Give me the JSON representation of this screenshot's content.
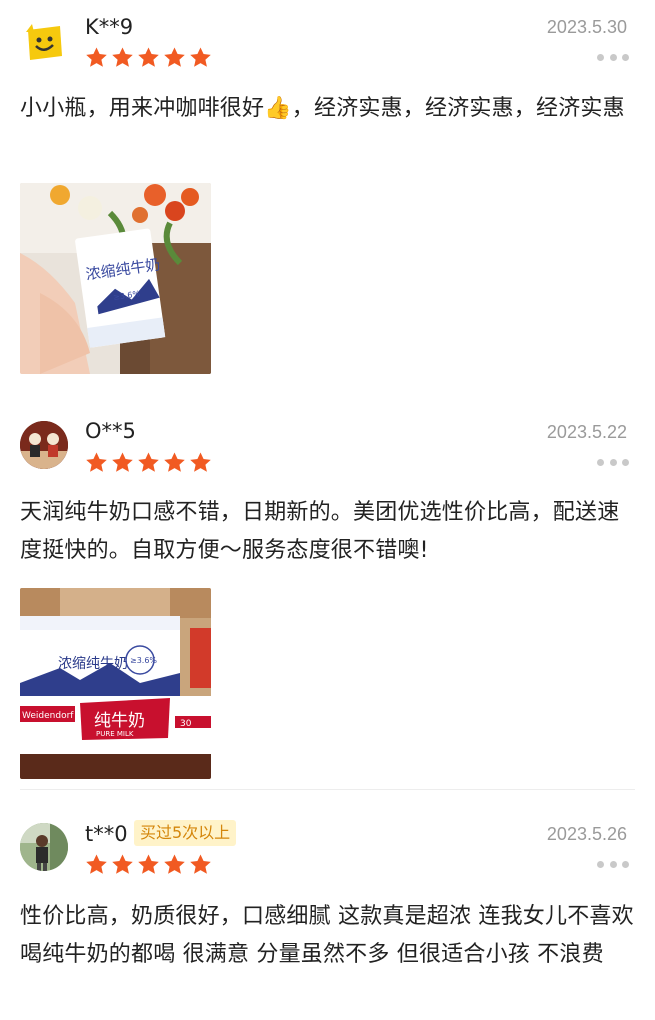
{
  "reviews": [
    {
      "user": "K**9",
      "date": "2023.5.30",
      "rating": 5,
      "text": "小小瓶，用来冲咖啡很好👍，经济实惠，经济实惠，经济实惠",
      "avatar_icon": "smiley-icon",
      "photo": {
        "product_name": "浓缩纯牛奶",
        "fat_label": "≥3.6%"
      }
    },
    {
      "user": "O**5",
      "date": "2023.5.22",
      "rating": 5,
      "text": "天润纯牛奶口感不错，日期新的。美团优选性价比高，配送速度挺快的。自取方便～服务态度很不错噢!",
      "avatar_icon": "figurines-avatar-icon",
      "photo": {
        "box_top_label": "浓缩纯牛奶",
        "box_top_fat": "≥3.6%",
        "box_bottom_label": "纯牛奶",
        "box_bottom_sub": "PURE MILK",
        "brand": "Weidendorf",
        "count_label": "30"
      }
    },
    {
      "user": "t**0",
      "badge": "买过5次以上",
      "date": "2023.5.26",
      "rating": 5,
      "text": "性价比高，奶质很好，口感细腻 这款真是超浓 连我女儿不喜欢喝纯牛奶的都喝 很满意 分量虽然不多 但很适合小孩 不浪费",
      "avatar_icon": "person-photo-avatar-icon"
    }
  ],
  "colors": {
    "star": "#f15a22",
    "badge_bg": "#fff3c9",
    "badge_text": "#d4860b",
    "date": "#9a9a9a"
  }
}
